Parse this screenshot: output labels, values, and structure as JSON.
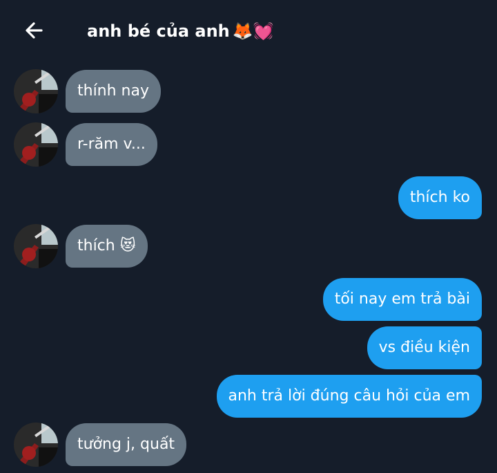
{
  "header": {
    "title": "anh bé của anh",
    "title_emojis": "🦊💓"
  },
  "messages": [
    {
      "side": "in",
      "text": "thính nay"
    },
    {
      "side": "in",
      "text": "r-răm v..."
    },
    {
      "side": "out",
      "text": "thích ko"
    },
    {
      "side": "in",
      "text": "thích 😻"
    },
    {
      "side": "out",
      "text": "tối nay em trả bài"
    },
    {
      "side": "out",
      "text": "vs điều kiện"
    },
    {
      "side": "out",
      "text": "anh trả lời đúng câu hỏi của em"
    },
    {
      "side": "in",
      "text": "tưởng j, quất"
    }
  ],
  "colors": {
    "background": "#151d2a",
    "incoming_bubble": "#657583",
    "outgoing_bubble": "#1e9ff0"
  }
}
